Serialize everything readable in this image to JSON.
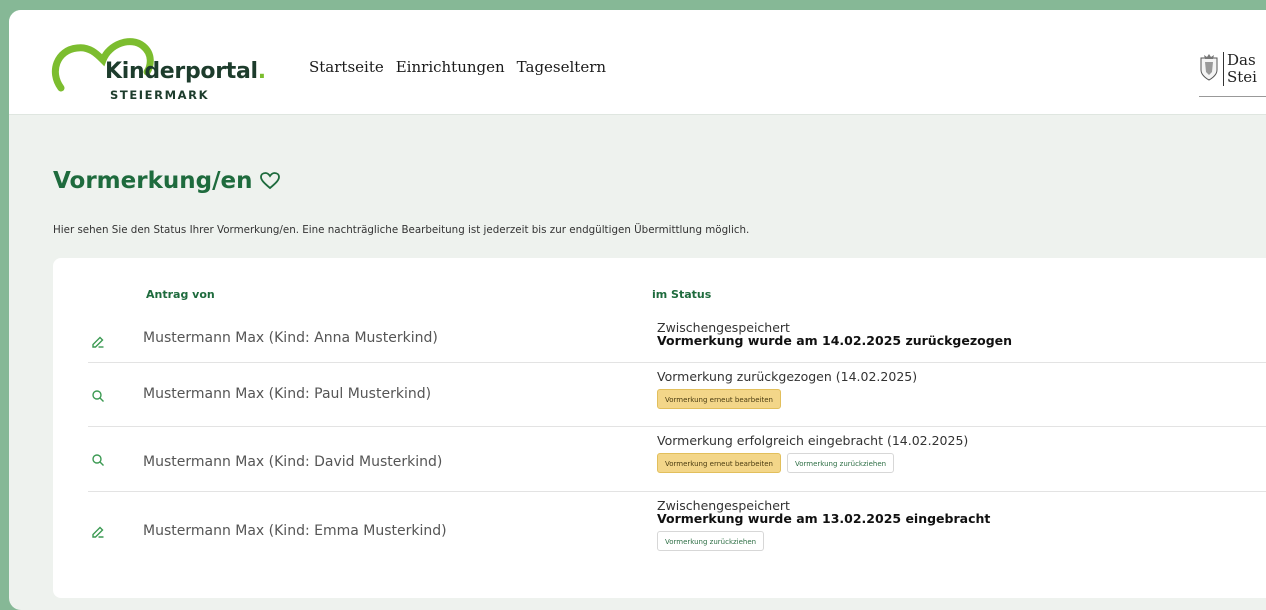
{
  "header": {
    "logo_name": "Kinderportal",
    "logo_dot": ".",
    "logo_sub": "STEIERMARK",
    "nav": [
      "Startseite",
      "Einrichtungen",
      "Tageseltern"
    ],
    "stmk_line1": "Das",
    "stmk_line2": "Stei"
  },
  "page": {
    "title": "Vormerkung/en",
    "description": "Hier sehen Sie den Status Ihrer Vormerkung/en. Eine nachträgliche Bearbeitung ist jederzeit bis zur endgültigen Übermittlung möglich."
  },
  "table": {
    "col_antrag": "Antrag von",
    "col_status": "im Status",
    "rows": [
      {
        "icon": "edit-icon",
        "name": "Mustermann Max (Kind: Anna Musterkind)",
        "status_line1": "Zwischengespeichert",
        "status_line2": "Vormerkung wurde am 14.02.2025 zurückgezogen"
      },
      {
        "icon": "search-icon",
        "name": "Mustermann Max (Kind: Paul Musterkind)",
        "status_line1": "Vormerkung zurückgezogen (14.02.2025)",
        "btn1": "Vormerkung erneut bearbeiten"
      },
      {
        "icon": "search-icon",
        "name": "Mustermann Max (Kind: David Musterkind)",
        "status_line1": "Vormerkung erfolgreich eingebracht (14.02.2025)",
        "btn1": "Vormerkung erneut bearbeiten",
        "btn2": "Vormerkung zurückziehen"
      },
      {
        "icon": "edit-icon",
        "name": "Mustermann Max (Kind: Emma Musterkind)",
        "status_line1": "Zwischengespeichert",
        "status_line2": "Vormerkung wurde am 13.02.2025 eingebracht",
        "btn1": "Vormerkung zurückziehen"
      }
    ]
  },
  "colors": {
    "brand_green": "#1e6b3d",
    "logo_green": "#7cbd2f",
    "button_yellow": "#f3d689",
    "background_green": "#86b896"
  }
}
